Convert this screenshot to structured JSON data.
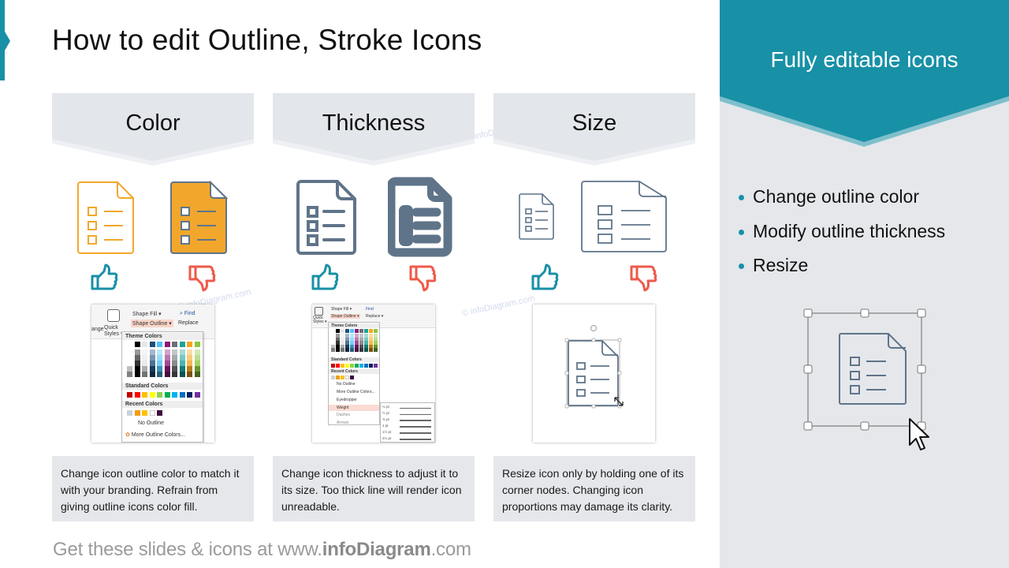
{
  "title": "How to edit Outline, Stroke Icons",
  "columns": [
    {
      "header": "Color",
      "description": "Change icon outline color to match it with your branding. Refrain from giving outline icons color fill.",
      "good_icon": "document-checklist-outline-orange-icon",
      "bad_icon": "document-checklist-filled-orange-icon"
    },
    {
      "header": "Thickness",
      "description": "Change icon thickness to adjust it to its size. Too thick line will render icon unreadable.",
      "good_icon": "document-checklist-thin-stroke-icon",
      "bad_icon": "document-checklist-thick-stroke-icon"
    },
    {
      "header": "Size",
      "description": "Resize icon only by holding one of its corner nodes. Changing icon proportions  may damage its clarity.",
      "good_icon": "document-checklist-proportional-icon",
      "bad_icon": "document-checklist-stretched-icon"
    }
  ],
  "ribbon_color": {
    "shape_fill": "Shape Fill ▾",
    "shape_outline": "Shape Outline ▾",
    "find": "Find",
    "replace": "Replace",
    "quick_styles": "Quick Styles ▾",
    "arrange": "ange",
    "theme_colors": "Theme Colors",
    "standard_colors": "Standard Colors",
    "recent_colors": "Recent Colors",
    "no_outline": "No Outline",
    "more_colors": "More Outline Colors..."
  },
  "ribbon_thickness": {
    "shape_fill": "Shape Fill ▾",
    "shape_outline": "Shape Outline ▾",
    "find": "Find",
    "replace": "Replace ▾",
    "quick_styles": "Quick Styles ▾",
    "theme_colors": "Theme Colors",
    "standard_colors": "Standard Colors",
    "recent_colors": "Recent Colors",
    "no_outline": "No Outline",
    "more_colors": "More Outline Colors...",
    "eyedropper": "Eyedropper",
    "weight": "Weight",
    "dashes": "Dashes",
    "arrows": "Arrows",
    "weights": [
      "¼ pt",
      "½ pt",
      "¾ pt",
      "1 pt",
      "1½ pt",
      "2¼ pt"
    ]
  },
  "palette": {
    "theme": [
      "#ffffff",
      "#000000",
      "#e7e6e6",
      "#1f4e79",
      "#4fc3f7",
      "#8b1a7a",
      "#6d6e71",
      "#1aa39a",
      "#f5a623",
      "#8cc63f"
    ],
    "standard": [
      "#c00000",
      "#ff0000",
      "#ffc000",
      "#ffff00",
      "#92d050",
      "#00b050",
      "#00b0f0",
      "#0070c0",
      "#002060",
      "#7030a0"
    ],
    "recent": [
      "#c8d3dc",
      "#f39c12",
      "#ffc000",
      "#ffffff",
      "#3d0a3d"
    ]
  },
  "right_panel": {
    "title": "Fully editable icons",
    "bullets": [
      "Change outline color",
      "Modify outline thickness",
      "Resize"
    ]
  },
  "footer": {
    "prefix": "Get these slides & icons at www.",
    "brand": "infoDiagram",
    "suffix": ".com"
  },
  "watermark": "© infoDiagram.com",
  "colors": {
    "accent": "#1890a6",
    "orange": "#f2a72c",
    "slate": "#5f7489",
    "thumb_up": "#1890a6",
    "thumb_down": "#ee5a4a",
    "panel_gray": "#e5e7eb"
  }
}
